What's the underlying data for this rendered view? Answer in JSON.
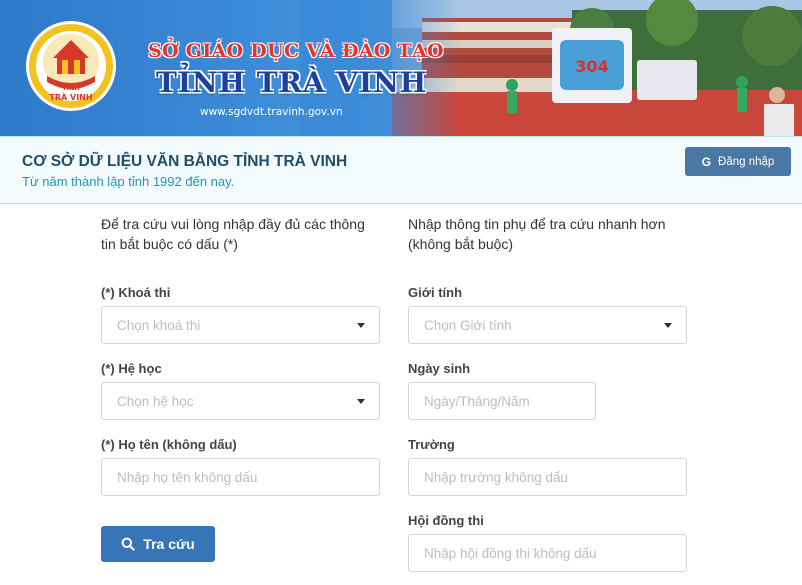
{
  "banner": {
    "title_line1": "SỞ GIÁO DỤC VÀ ĐÀO TẠO",
    "title_line2": "TỈNH TRÀ VINH",
    "url": "www.sgdvdt.travinh.gov.vn",
    "logo_text_top": "TỈNH",
    "logo_text_bottom": "TRÀ VINH"
  },
  "header": {
    "title": "CƠ SỞ DỮ LIỆU VĂN BẰNG TỈNH TRÀ VINH",
    "subtitle": "Từ năm thành lập tỉnh 1992 đến nay.",
    "login_icon": "google-icon",
    "login_label": "Đăng nhập"
  },
  "form": {
    "required_intro": "Để tra cứu vui lòng nhập đầy đủ các thông tin bắt buộc có dấu (*)",
    "optional_intro": "Nhập thông tin phụ để tra cứu nhanh hơn (không bắt buộc)",
    "exam_label": "(*) Khoá thi",
    "exam_placeholder": "Chọn khoá thi",
    "system_label": "(*) Hệ học",
    "system_placeholder": "Chọn hệ học",
    "name_label": "(*) Họ tên (không dấu)",
    "name_placeholder": "Nhập họ tên không dấu",
    "gender_label": "Giới tính",
    "gender_placeholder": "Chọn Giới tính",
    "dob_label": "Ngày sinh",
    "dob_placeholder": "Ngày/Tháng/Năm",
    "school_label": "Trường",
    "school_placeholder": "Nhập trường không dấu",
    "council_label": "Hội đồng thi",
    "council_placeholder": "Nhập hội đồng thi không dấu",
    "search_label": "Tra cứu"
  },
  "colors": {
    "banner_blue": "#3b8ad8",
    "title_red": "#e8322b",
    "title_blue": "#1c3fa0",
    "login_button": "#4a77a3",
    "search_button": "#3875b8"
  }
}
